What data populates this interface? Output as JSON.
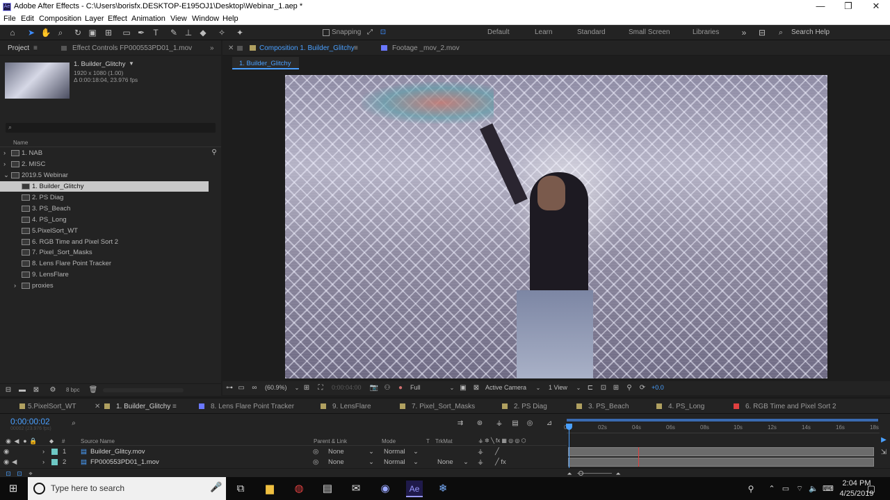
{
  "window": {
    "title": "Adobe After Effects - C:\\Users\\borisfx.DESKTOP-E195OJ1\\Desktop\\Webinar_1.aep *",
    "app_icon": "Ae",
    "minimize": "—",
    "maximize": "❐",
    "close": "✕"
  },
  "menu": [
    "File",
    "Edit",
    "Composition",
    "Layer",
    "Effect",
    "Animation",
    "View",
    "Window",
    "Help"
  ],
  "toolbar": {
    "snapping_label": "Snapping",
    "workspaces": [
      "Default",
      "Learn",
      "Standard",
      "Small Screen",
      "Libraries"
    ],
    "search_help": "Search Help"
  },
  "project": {
    "tab_label": "Project",
    "effect_controls_tab": "Effect Controls FP000553PD01_1.mov",
    "selected_name": "1. Builder_Glitchy",
    "selected_info_1": "1920 x 1080 (1.00)",
    "selected_info_2": "Δ 0:00:18:04, 23.976 fps",
    "search_placeholder": "",
    "column_name": "Name",
    "items": [
      {
        "label": "1. NAB",
        "type": "folder"
      },
      {
        "label": "2. MISC",
        "type": "folder"
      },
      {
        "label": "2019.5 Webinar",
        "type": "folder-open"
      },
      {
        "label": "1. Builder_Glitchy",
        "type": "comp"
      },
      {
        "label": "2. PS Diag",
        "type": "comp"
      },
      {
        "label": "3. PS_Beach",
        "type": "comp"
      },
      {
        "label": "4. PS_Long",
        "type": "comp"
      },
      {
        "label": "5.PixelSort_WT",
        "type": "comp"
      },
      {
        "label": "6. RGB Time and Pixel Sort 2",
        "type": "comp"
      },
      {
        "label": "7. Pixel_Sort_Masks",
        "type": "comp"
      },
      {
        "label": "8. Lens Flare Point Tracker",
        "type": "comp"
      },
      {
        "label": "9. LensFlare",
        "type": "comp"
      },
      {
        "label": "proxies",
        "type": "folder"
      }
    ],
    "bpc": "8 bpc"
  },
  "composition": {
    "tab_label": "Composition 1. Builder_Glitchy",
    "footage_tab": "Footage _mov_2.mov",
    "breadcrumb": "1. Builder_Glitchy",
    "zoom": "(60.9%)",
    "timecode": "0:00:04:00",
    "resolution": "Full",
    "camera": "Active Camera",
    "views": "1 View",
    "exposure": "+0.0"
  },
  "timeline": {
    "tabs": [
      {
        "label": "5.PixelSort_WT",
        "color": "#b0a060"
      },
      {
        "label": "1. Builder_Glitchy",
        "color": "#b0a060"
      },
      {
        "label": "8. Lens Flare Point Tracker",
        "color": "#6a78ff"
      },
      {
        "label": "9. LensFlare",
        "color": "#b0a060"
      },
      {
        "label": "7. Pixel_Sort_Masks",
        "color": "#b0a060"
      },
      {
        "label": "2. PS Diag",
        "color": "#b0a060"
      },
      {
        "label": "3. PS_Beach",
        "color": "#b0a060"
      },
      {
        "label": "4. PS_Long",
        "color": "#b0a060"
      },
      {
        "label": "6. RGB Time and Pixel Sort 2",
        "color": "#e04040"
      }
    ],
    "current_time": "0:00:00:02",
    "current_frames": "00002 (23.976 fps)",
    "columns": {
      "source_name": "Source Name",
      "parent": "Parent & Link",
      "mode": "Mode",
      "t": "T",
      "trkmat": "TrkMat"
    },
    "ruler": [
      "0s",
      "02s",
      "04s",
      "06s",
      "08s",
      "10s",
      "12s",
      "14s",
      "16s",
      "18s"
    ],
    "layers": [
      {
        "num": "1",
        "name": "Builder_Glitcy.mov",
        "parent": "None",
        "mode": "Normal",
        "trkmat": ""
      },
      {
        "num": "2",
        "name": "FP000553PD01_1.mov",
        "parent": "None",
        "mode": "Normal",
        "trkmat": "None"
      }
    ]
  },
  "taskbar": {
    "search_placeholder": "Type here to search",
    "time": "2:04 PM",
    "date": "4/25/2019"
  }
}
